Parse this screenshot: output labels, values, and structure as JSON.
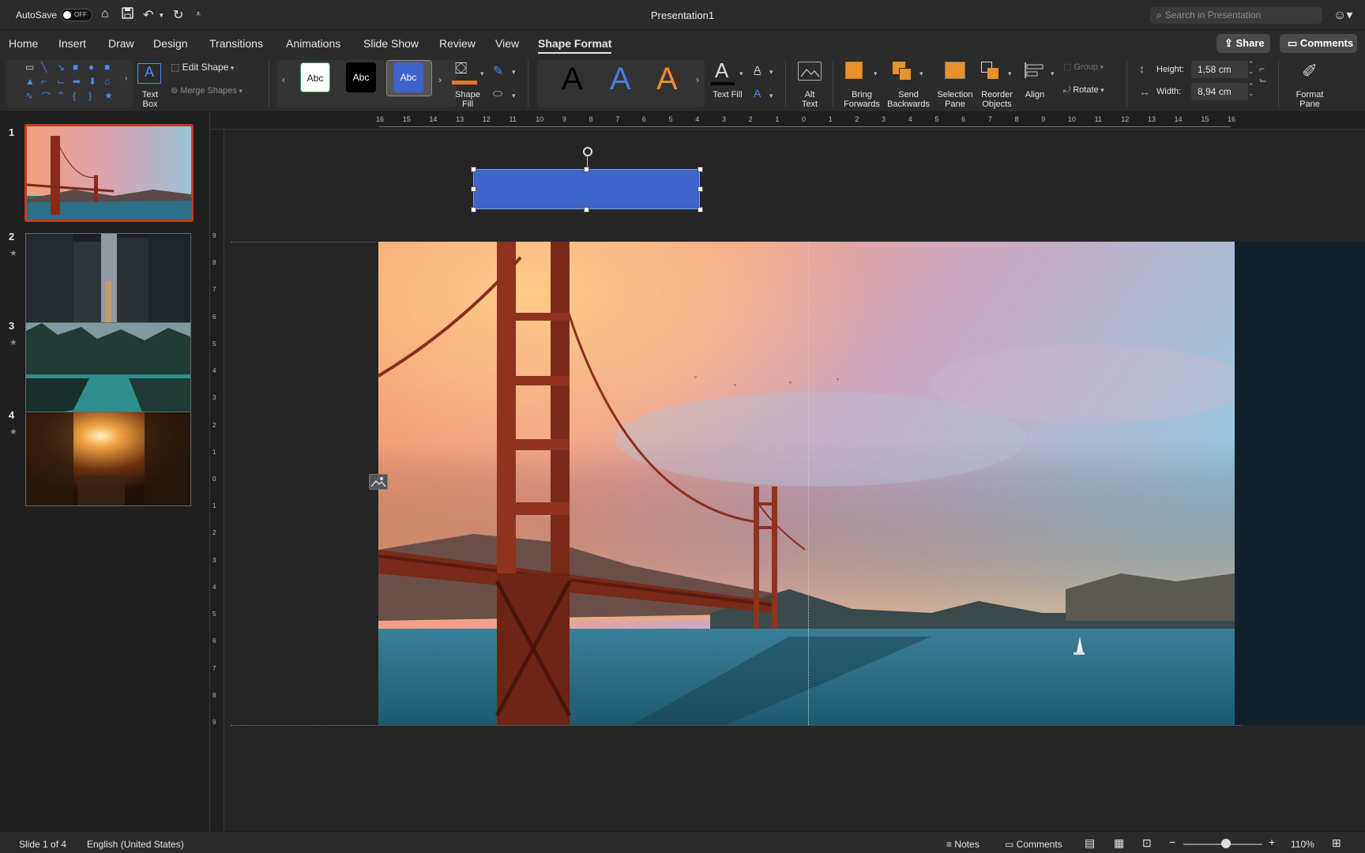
{
  "titlebar": {
    "autosave_label": "AutoSave",
    "autosave_state": "OFF",
    "title": "Presentation1",
    "search_placeholder": "Search in Presentation"
  },
  "menu": {
    "tabs": [
      "Home",
      "Insert",
      "Draw",
      "Design",
      "Transitions",
      "Animations",
      "Slide Show",
      "Review",
      "View",
      "Shape Format"
    ],
    "active_tab": "Shape Format",
    "share_label": "Share",
    "comments_label": "Comments"
  },
  "ribbon": {
    "text_box_label": "Text\nBox",
    "edit_shape_label": "Edit Shape",
    "merge_shapes_label": "Merge Shapes",
    "style_swatches": [
      "Abc",
      "Abc",
      "Abc"
    ],
    "shape_fill_label": "Shape\nFill",
    "wordart_glyph": "A",
    "text_fill_label": "Text Fill",
    "alt_text_label": "Alt\nText",
    "bring_forwards_label": "Bring\nForwards",
    "send_backwards_label": "Send\nBackwards",
    "selection_pane_label": "Selection\nPane",
    "reorder_objects_label": "Reorder\nObjects",
    "align_label": "Align",
    "group_label": "Group",
    "rotate_label": "Rotate",
    "height_label": "Height:",
    "height_value": "1,58 cm",
    "width_label": "Width:",
    "width_value": "8,94 cm",
    "format_pane_label": "Format\nPane"
  },
  "slides": [
    {
      "number": "1",
      "selected": true,
      "star": false
    },
    {
      "number": "2",
      "selected": false,
      "star": true
    },
    {
      "number": "3",
      "selected": false,
      "star": true
    },
    {
      "number": "4",
      "selected": false,
      "star": true
    }
  ],
  "ruler": {
    "numbers": [
      "16",
      "15",
      "14",
      "13",
      "12",
      "11",
      "10",
      "9",
      "8",
      "7",
      "6",
      "5",
      "4",
      "3",
      "2",
      "1",
      "0",
      "1",
      "2",
      "3",
      "4",
      "5",
      "6",
      "7",
      "8",
      "9",
      "10",
      "11",
      "12",
      "13",
      "14",
      "15",
      "16"
    ],
    "vnumbers": [
      "9",
      "8",
      "7",
      "6",
      "5",
      "4",
      "3",
      "2",
      "1",
      "0",
      "1",
      "2",
      "3",
      "4",
      "5",
      "6",
      "7",
      "8",
      "9"
    ]
  },
  "status": {
    "slide_info": "Slide 1 of 4",
    "language": "English (United States)",
    "notes_label": "Notes",
    "comments_label": "Comments",
    "zoom": "110%"
  },
  "colors": {
    "accent": "#3e63c9",
    "selection_border": "#c23b22",
    "shape_fill": "#e8762c"
  }
}
